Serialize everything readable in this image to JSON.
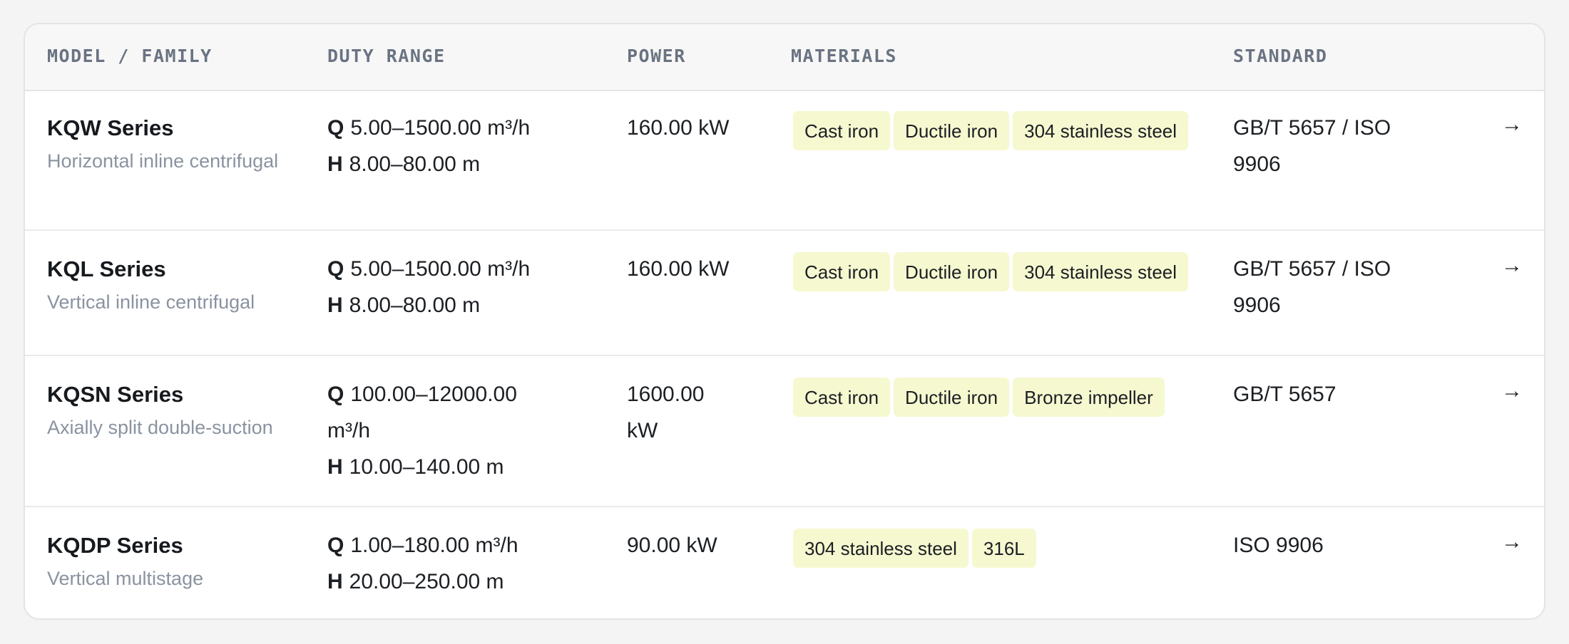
{
  "columns": {
    "model": "MODEL / FAMILY",
    "duty": "DUTY RANGE",
    "power": "POWER",
    "materials": "MATERIALS",
    "standard": "STANDARD"
  },
  "duty_keys": {
    "q": "Q",
    "h": "H"
  },
  "arrow_icon": "arrow-right-icon",
  "arrow_glyph": "→",
  "rows": [
    {
      "name": "KQW Series",
      "subtitle": "Horizontal inline centrifugal",
      "q": "5.00–1500.00 m³/h",
      "h": "8.00–80.00 m",
      "power": "160.00 kW",
      "materials": [
        "Cast iron",
        "Ductile iron",
        "304 stainless steel"
      ],
      "standard": "GB/T 5657 / ISO 9906"
    },
    {
      "name": "KQL Series",
      "subtitle": "Vertical inline centrifugal",
      "q": "5.00–1500.00 m³/h",
      "h": "8.00–80.00 m",
      "power": "160.00 kW",
      "materials": [
        "Cast iron",
        "Ductile iron",
        "304 stainless steel"
      ],
      "standard": "GB/T 5657 / ISO 9906"
    },
    {
      "name": "KQSN Series",
      "subtitle": "Axially split double-suction",
      "q": "100.00–12000.00 m³/h",
      "h": "10.00–140.00 m",
      "power": "1600.00 kW",
      "materials": [
        "Cast iron",
        "Ductile iron",
        "Bronze impeller"
      ],
      "standard": "GB/T 5657"
    },
    {
      "name": "KQDP Series",
      "subtitle": "Vertical multistage",
      "q": "1.00–180.00 m³/h",
      "h": "20.00–250.00 m",
      "power": "90.00 kW",
      "materials": [
        "304 stainless steel",
        "316L"
      ],
      "standard": "ISO 9906"
    }
  ],
  "colors": {
    "tag_background": "#f6f8d0",
    "header_text": "#6a7382",
    "subtitle_text": "#8a93a0"
  }
}
